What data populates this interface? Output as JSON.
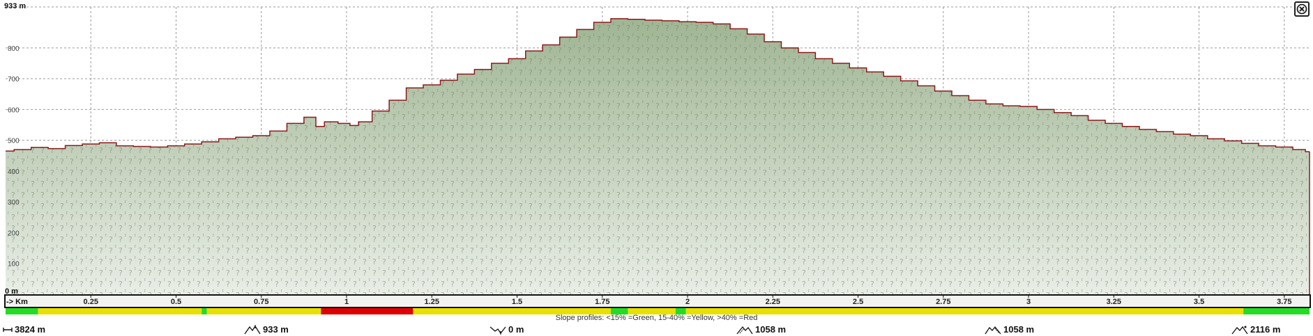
{
  "chart_data": {
    "type": "area",
    "title": "",
    "xlabel": "-> Km",
    "ylabel": "",
    "y_top_label": "933 m",
    "y_zero_label": "0 m",
    "xlim": [
      0,
      3.824
    ],
    "ylim": [
      0,
      933
    ],
    "x_ticks": [
      0.25,
      0.5,
      0.75,
      1,
      1.25,
      1.5,
      1.75,
      2,
      2.25,
      2.5,
      2.75,
      3,
      3.25,
      3.5,
      3.75
    ],
    "x_tick_labels": [
      "0.25",
      "0.5",
      "0.75",
      "1",
      "1.25",
      "1.5",
      "1.75",
      "2",
      "2.25",
      "2.5",
      "2.75",
      "3",
      "3.25",
      "3.5",
      "3.75"
    ],
    "y_ticks": [
      100,
      200,
      300,
      400,
      500,
      600,
      700,
      800
    ],
    "y_tick_labels": [
      "100",
      "200",
      "300",
      "400",
      "500",
      "600",
      "700",
      "800"
    ],
    "grid": true,
    "series": [
      {
        "x": [
          0,
          0.05,
          0.1,
          0.15,
          0.2,
          0.25,
          0.3,
          0.35,
          0.4,
          0.45,
          0.5,
          0.55,
          0.6,
          0.65,
          0.7,
          0.75,
          0.8,
          0.85,
          0.9,
          0.92,
          0.95,
          1.0,
          1.02,
          1.05,
          1.1,
          1.15,
          1.2,
          1.25,
          1.3,
          1.35,
          1.4,
          1.45,
          1.5,
          1.55,
          1.6,
          1.65,
          1.7,
          1.75,
          1.8,
          1.85,
          1.9,
          1.95,
          2.0,
          2.05,
          2.1,
          2.15,
          2.2,
          2.25,
          2.3,
          2.35,
          2.4,
          2.45,
          2.5,
          2.55,
          2.6,
          2.65,
          2.7,
          2.75,
          2.8,
          2.85,
          2.9,
          2.95,
          3.0,
          3.05,
          3.1,
          3.15,
          3.2,
          3.25,
          3.3,
          3.35,
          3.4,
          3.45,
          3.5,
          3.55,
          3.6,
          3.65,
          3.7,
          3.75,
          3.8,
          3.824
        ],
        "y": [
          465,
          470,
          477,
          473,
          483,
          488,
          492,
          482,
          480,
          478,
          482,
          488,
          495,
          505,
          510,
          515,
          530,
          555,
          575,
          545,
          560,
          555,
          548,
          560,
          595,
          630,
          670,
          680,
          695,
          715,
          730,
          750,
          765,
          790,
          810,
          835,
          860,
          883,
          895,
          893,
          890,
          888,
          885,
          883,
          878,
          862,
          845,
          820,
          800,
          785,
          765,
          750,
          735,
          722,
          708,
          693,
          677,
          660,
          645,
          630,
          618,
          612,
          610,
          600,
          590,
          580,
          565,
          555,
          545,
          535,
          528,
          520,
          515,
          505,
          498,
          490,
          482,
          478,
          470,
          463
        ]
      }
    ],
    "slope_bar": [
      {
        "from": 0,
        "to": 0.095,
        "class": "green"
      },
      {
        "from": 0.095,
        "to": 0.575,
        "class": "yellow"
      },
      {
        "from": 0.575,
        "to": 0.59,
        "class": "green"
      },
      {
        "from": 0.59,
        "to": 0.925,
        "class": "yellow"
      },
      {
        "from": 0.925,
        "to": 1.195,
        "class": "red"
      },
      {
        "from": 1.195,
        "to": 1.775,
        "class": "yellow"
      },
      {
        "from": 1.775,
        "to": 1.825,
        "class": "green"
      },
      {
        "from": 1.825,
        "to": 1.965,
        "class": "yellow"
      },
      {
        "from": 1.965,
        "to": 1.995,
        "class": "green"
      },
      {
        "from": 1.995,
        "to": 3.63,
        "class": "yellow"
      },
      {
        "from": 3.63,
        "to": 3.824,
        "class": "green"
      }
    ]
  },
  "colors": {
    "fill": "#a8bc9c",
    "fill_light": "#dfe6da",
    "outline": "#8b1a1a",
    "green": "#22dd22",
    "yellow": "#e8e000",
    "red": "#e00000",
    "grid": "#9a9a9a"
  },
  "slope_note": "Slope profiles: <15% =Green, 15-40% =Yellow, >40% =Red",
  "stats": {
    "distance": "3824 m",
    "max_altitude": "933 m",
    "min_altitude": "0 m",
    "ascent": "1058 m",
    "descent": "1058 m",
    "duration": "2116 m"
  },
  "icons": {
    "close": "close-icon",
    "distance": "distance-icon",
    "max": "max-altitude-icon",
    "min": "min-altitude-icon",
    "ascent": "ascent-icon",
    "descent": "descent-icon",
    "time": "hiker-icon"
  }
}
